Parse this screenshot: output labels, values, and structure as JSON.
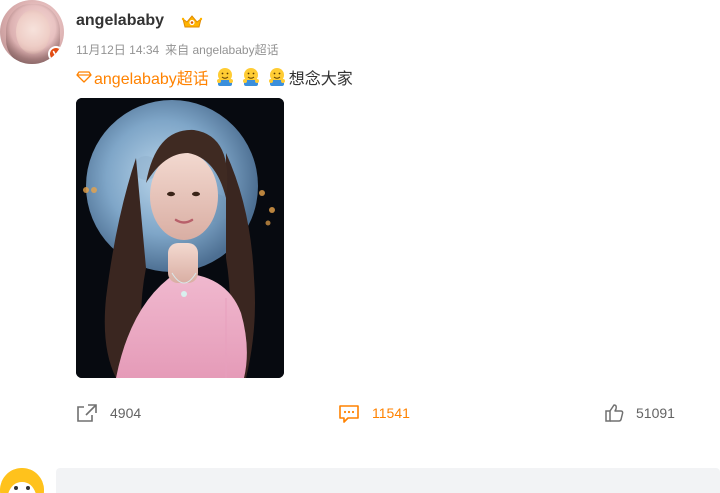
{
  "post": {
    "username": "angelababy",
    "timestamp": "11月12日 14:34",
    "source": "来自 angelababy超话",
    "topic_link": "angelababy超话",
    "text": "想念大家"
  },
  "icons": {
    "verified": "verified-badge-icon",
    "crown": "crown-icon",
    "topic": "diamond-topic-icon",
    "emoji": "hug-emoji-icon",
    "repost": "repost-icon",
    "comment": "comment-icon",
    "like": "like-icon"
  },
  "actions": {
    "repost_count": "4904",
    "comment_count": "11541",
    "like_count": "51091"
  },
  "colors": {
    "accent": "#ff8200",
    "username": "#333333",
    "meta": "#939393",
    "verified": "#e34d13"
  }
}
